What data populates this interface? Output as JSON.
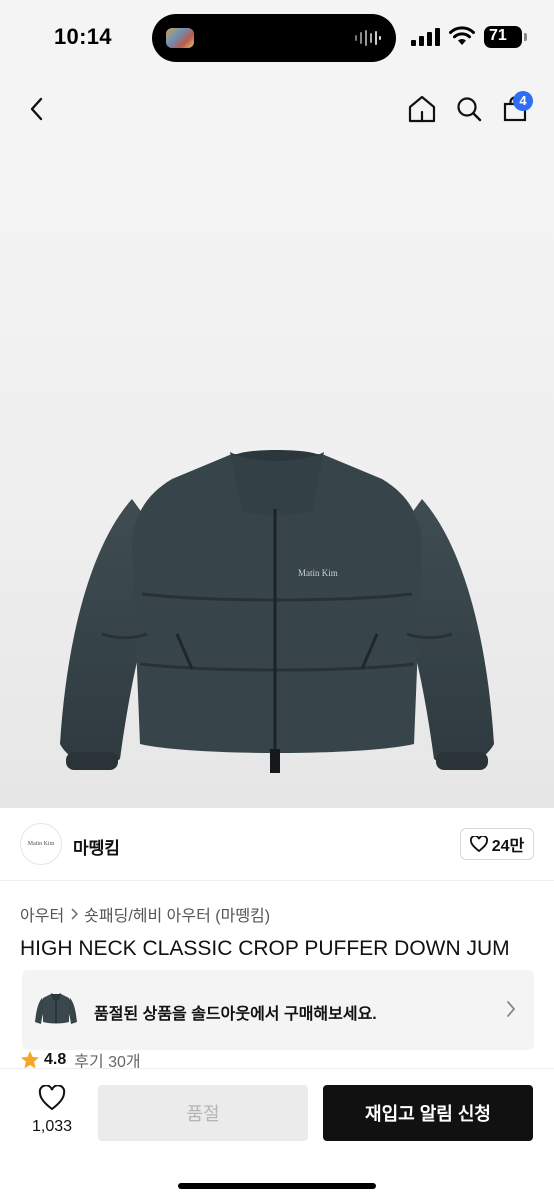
{
  "status_bar": {
    "time": "10:14",
    "battery": "71",
    "icons": [
      "cellular-signal-icon",
      "wifi-icon",
      "battery-icon"
    ]
  },
  "header": {
    "icons": [
      "back-chevron-icon",
      "home-icon",
      "search-icon",
      "shopping-bag-icon"
    ],
    "cart_count": "4",
    "accent_color": "#2f6df6"
  },
  "product_image": {
    "logo_text": "Matin Kim"
  },
  "brand": {
    "name": "마뗑킴",
    "logo_text": "Matin Kim",
    "likes": "24만"
  },
  "breadcrumb": {
    "level1": "아우터",
    "level2": "숏패딩/헤비 아우터 (마뗑킴)"
  },
  "product": {
    "title": "HIGH NECK CLASSIC CROP PUFFER DOWN JUM"
  },
  "soldout_banner": {
    "text": "품절된 상품을 솔드아웃에서 구매해보세요."
  },
  "rating": {
    "score": "4.8",
    "reviews": "후기 30개",
    "star_color": "#f5a623"
  },
  "bottom_bar": {
    "wish_count": "1,033",
    "soldout_label": "품절",
    "restock_label": "재입고 알림 신청"
  }
}
